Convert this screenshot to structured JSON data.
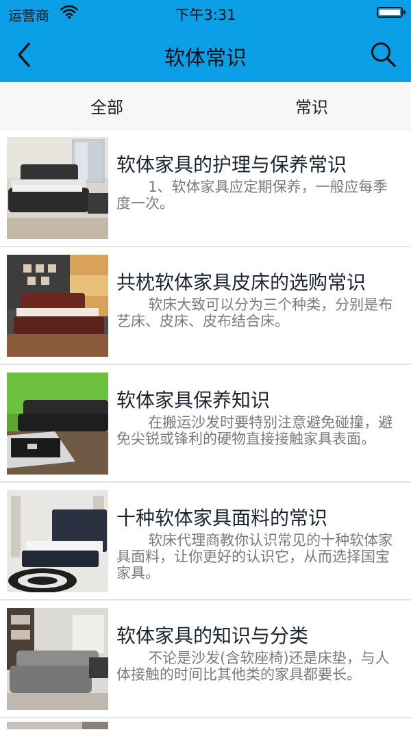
{
  "status_bar": {
    "carrier": "运营商",
    "time": "下午3:31",
    "icons": [
      "wifi-icon",
      "battery-icon"
    ]
  },
  "nav": {
    "title": "软体常识",
    "back_icon": "chevron-left-icon",
    "search_icon": "search-icon"
  },
  "tabs": [
    {
      "label": "全部"
    },
    {
      "label": "常识"
    }
  ],
  "articles": [
    {
      "title": "软体家具的护理与保养常识",
      "summary": "1、软体家具应定期保养，一般应每季度一次。"
    },
    {
      "title": "共枕软体家具皮床的选购常识",
      "summary": "软床大致可以分为三个种类，分别是布艺床、皮床、皮布结合床。"
    },
    {
      "title": "软体家具保养知识",
      "summary": "在搬运沙发时要特别注意避免碰撞，避免尖锐或锋利的硬物直接接触家具表面。"
    },
    {
      "title": "十种软体家具面料的常识",
      "summary": "软床代理商教你认识常见的十种软体家具面料，让你更好的认识它，从而选择国宝家具。"
    },
    {
      "title": "软体家具的知识与分类",
      "summary": "不论是沙发(含软座椅)还是床垫，与人体接触的时间比其他类的家具都要长。"
    }
  ],
  "colors": {
    "header": "#0a9fe6",
    "tab_bar": "#f7f7f7",
    "title_text": "#1b2430",
    "summary_text": "#7a7a7a",
    "divider": "#e4e4e4"
  }
}
